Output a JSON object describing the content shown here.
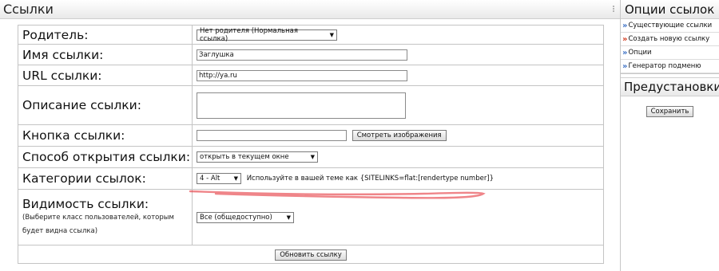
{
  "main": {
    "title": "Ссылки"
  },
  "form": {
    "parent": {
      "label": "Родитель:",
      "value": "Нет родителя (Нормальная ссылка)"
    },
    "link_name": {
      "label": "Имя ссылки:",
      "value": "Заглушка"
    },
    "link_url": {
      "label": "URL ссылки:",
      "value": "http://ya.ru"
    },
    "description": {
      "label": "Описание ссылки:",
      "value": ""
    },
    "button": {
      "label": "Кнопка ссылки:",
      "value": "",
      "view_images_label": "Смотреть изображения"
    },
    "open_mode": {
      "label": "Способ открытия ссылки:",
      "value": "открыть в текущем окне"
    },
    "categories": {
      "label": "Категории ссылок:",
      "value": "4 - Alt",
      "hint": "Используйте в вашей теме как {SITELINKS=flat:[rendertype number]}"
    },
    "visibility": {
      "label": "Видимость ссылки:",
      "sublabel": "(Выберите класс пользователей, которым будет видна ссылка)",
      "value": "Все (общедоступно)"
    },
    "submit_label": "Обновить ссылку"
  },
  "sidebar": {
    "title": "Опции ссылок",
    "items": [
      {
        "label": "Существующие ссылки",
        "chevron_color": "#3a6fc4"
      },
      {
        "label": "Создать новую ссылку",
        "chevron_color": "#d23a1e"
      },
      {
        "label": "Опции",
        "chevron_color": "#3a6fc4"
      },
      {
        "label": "Генератор подменю",
        "chevron_color": "#3a6fc4"
      }
    ],
    "presets_title": "Предустановки",
    "save_label": "Сохранить"
  },
  "colors": {
    "annotation": "#e5333b"
  }
}
